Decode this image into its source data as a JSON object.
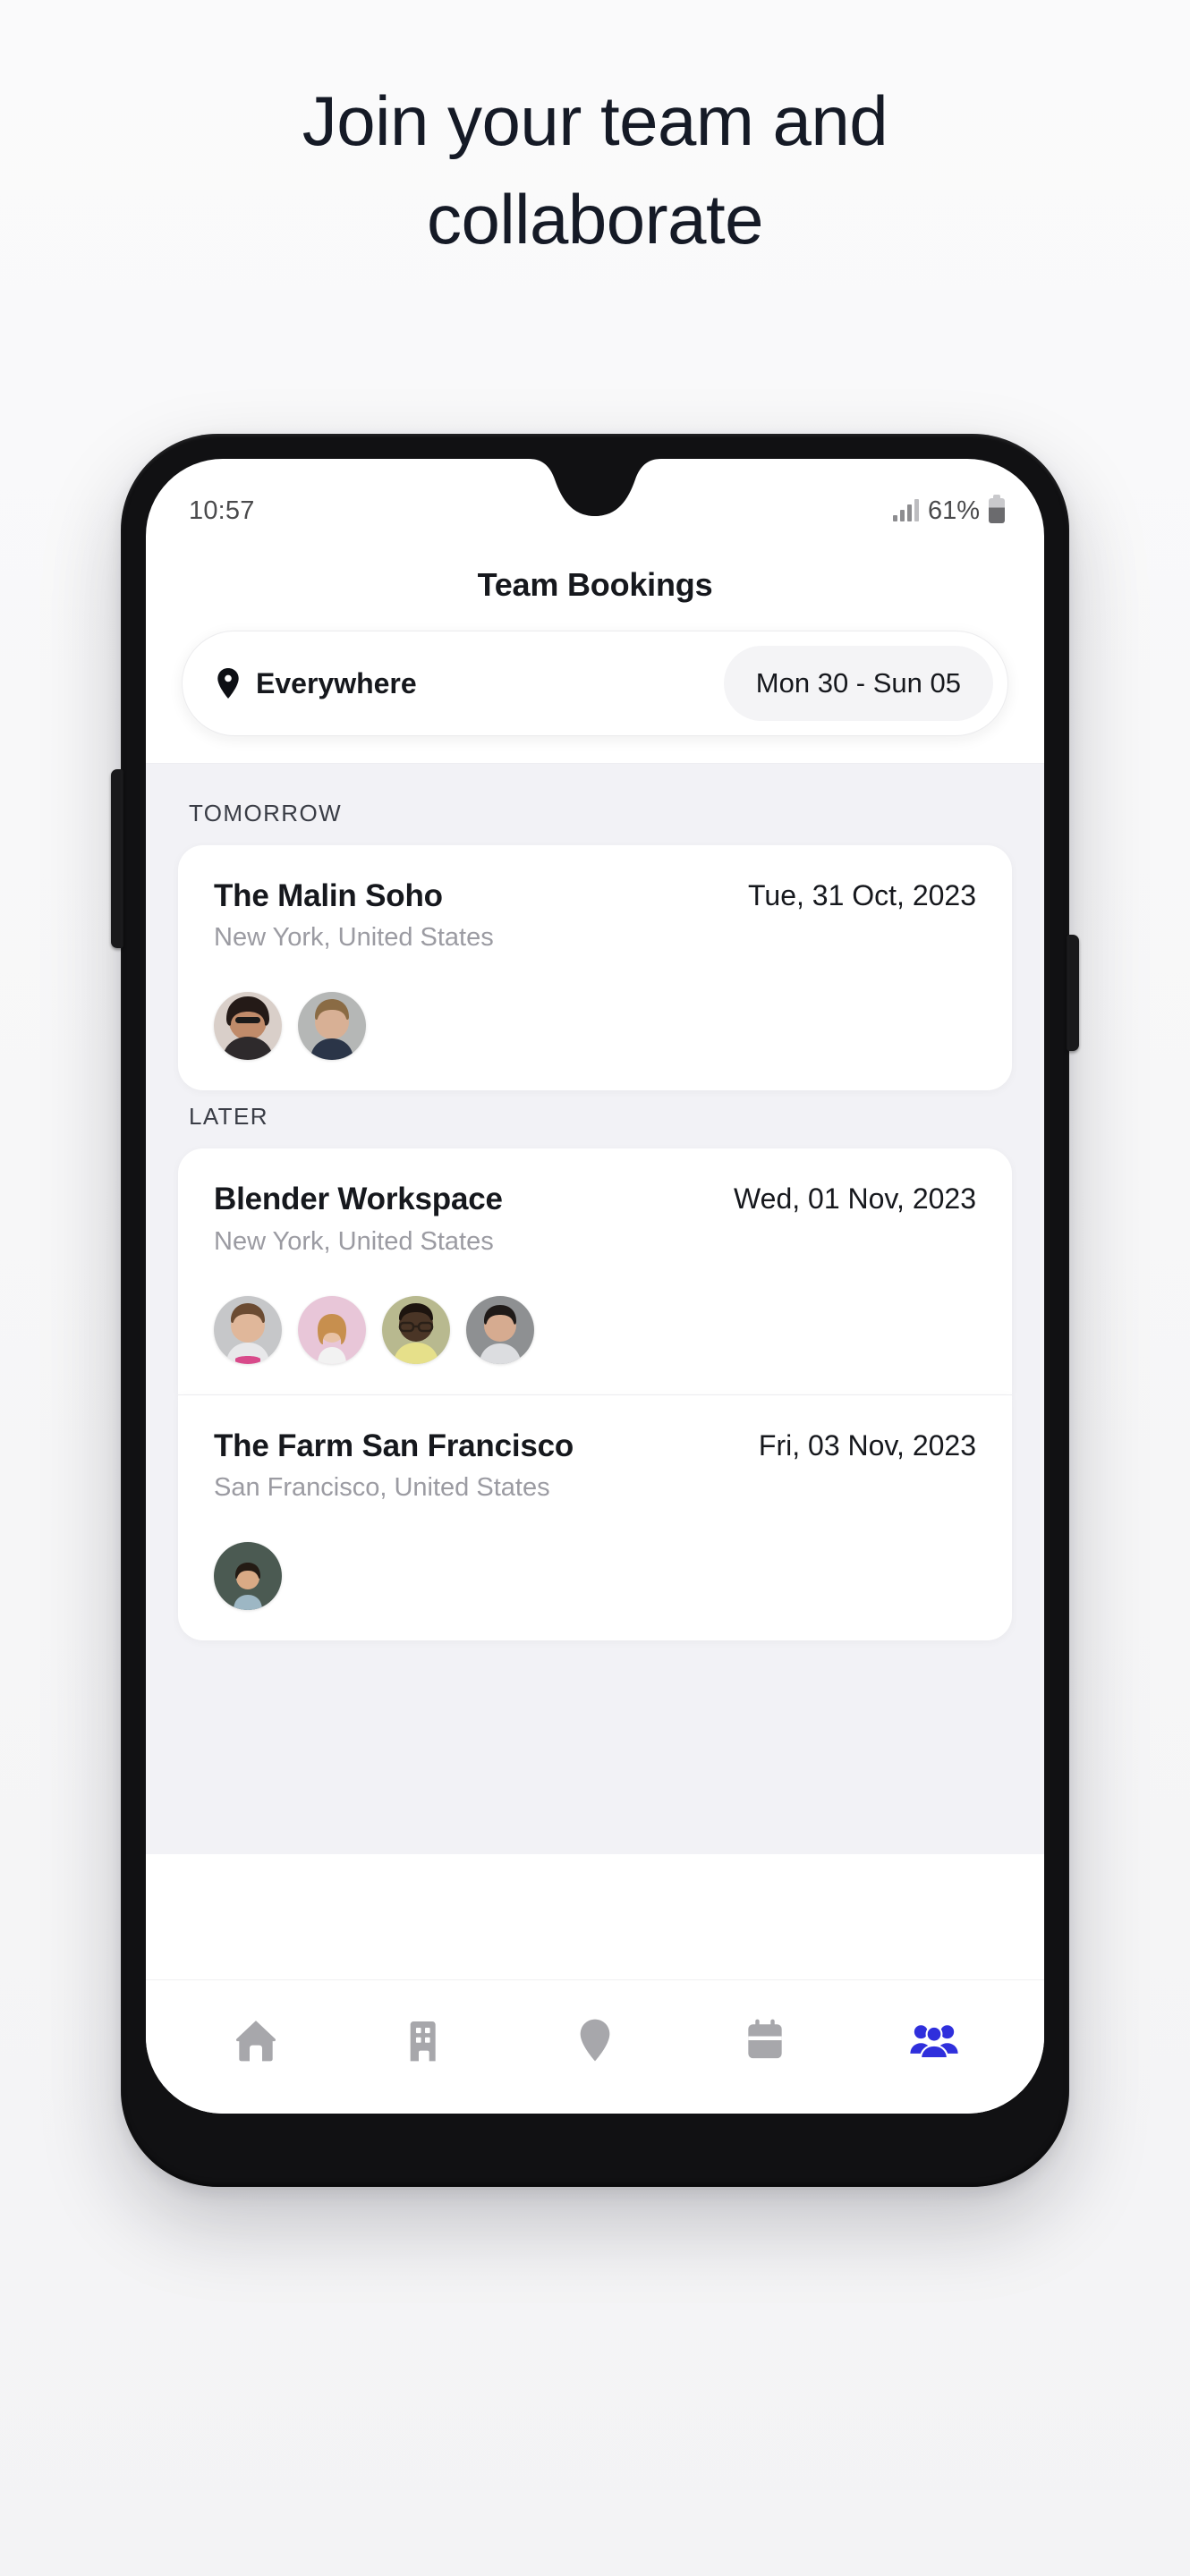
{
  "headline": {
    "line1": "Join your team and",
    "line2": "collaborate"
  },
  "phone": {
    "status_bar": {
      "time": "10:57",
      "battery_percent": "61%",
      "signal_icon": "signal-bars-icon",
      "battery_icon": "battery-icon"
    },
    "app": {
      "title": "Team Bookings",
      "search": {
        "location_icon": "location-pin-icon",
        "location_label": "Everywhere",
        "date_range": "Mon 30 - Sun 05"
      },
      "sections": [
        {
          "label": "TOMORROW",
          "cards": [
            {
              "name": "The Malin Soho",
              "date": "Tue, 31 Oct, 2023",
              "location": "New York, United States",
              "avatars": [
                {
                  "name": "avatar-member-1",
                  "bg": "#d9cfc9",
                  "skin": "#c08b6a",
                  "hair": "#241a17",
                  "shirt": "#2e2a2c"
                },
                {
                  "name": "avatar-member-2",
                  "bg": "#b5b7b6",
                  "skin": "#d8b095",
                  "hair": "#8a6b44",
                  "shirt": "#2b3548"
                }
              ]
            }
          ]
        },
        {
          "label": "LATER",
          "cards": [
            {
              "name": "Blender Workspace",
              "date": "Wed, 01 Nov, 2023",
              "location": "New York, United States",
              "avatars": [
                {
                  "name": "avatar-member-3",
                  "bg": "#c6c7c9",
                  "skin": "#e0b79a",
                  "hair": "#6b4b32",
                  "shirt": "#e8e8ea"
                },
                {
                  "name": "avatar-member-4",
                  "bg": "#e8c6d8",
                  "skin": "#e8c2a4",
                  "hair": "#c78f4e",
                  "shirt": "#f2f2f2"
                },
                {
                  "name": "avatar-member-5",
                  "bg": "#b8b98f",
                  "skin": "#4a3526",
                  "hair": "#1d140f",
                  "shirt": "#e6e08a"
                },
                {
                  "name": "avatar-member-6",
                  "bg": "#8e9092",
                  "skin": "#d6ab90",
                  "hair": "#1f1a18",
                  "shirt": "#dcdde0"
                }
              ]
            },
            {
              "name": "The Farm San Francisco",
              "date": "Fri, 03 Nov, 2023",
              "location": "San Francisco, United States",
              "avatars": [
                {
                  "name": "avatar-member-7",
                  "bg": "#4b5a52",
                  "skin": "#d9aa85",
                  "hair": "#241b14",
                  "shirt": "#9db7c4"
                }
              ]
            }
          ]
        }
      ],
      "tabs": [
        {
          "icon": "home-icon",
          "active": false
        },
        {
          "icon": "building-icon",
          "active": false
        },
        {
          "icon": "map-pin-icon",
          "active": false
        },
        {
          "icon": "calendar-icon",
          "active": false
        },
        {
          "icon": "team-people-icon",
          "active": true
        }
      ]
    }
  },
  "colors": {
    "accent": "#2f2fdc",
    "inactive_tab": "#a7a7ab",
    "headline": "#151a26",
    "muted_text": "#9b9ba2",
    "list_bg": "#f2f2f6"
  }
}
